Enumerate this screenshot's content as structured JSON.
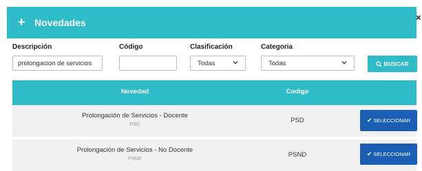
{
  "header": {
    "plus_icon": "+",
    "title": "Novedades",
    "close_icon": "×"
  },
  "filters": {
    "descripcion_label": "Descripción",
    "descripcion_value": "prolongacion de servicios",
    "codigo_label": "Código",
    "codigo_value": "",
    "clasificacion_label": "Clasificación",
    "clasificacion_value": "Todas",
    "categoria_label": "Categoria",
    "categoria_value": "Todas",
    "buscar_label": "BUSCAR"
  },
  "table": {
    "headers": [
      "Novedad",
      "Codigo"
    ],
    "rows": [
      {
        "description": "Prolongación de Servicios - Docente",
        "sub": "PSD",
        "code": "PSD",
        "action": "SELECCIONAR"
      },
      {
        "description": "Prolongación de Servicios - No Docente",
        "sub": "PSND",
        "code": "PSND",
        "action": "SELECCIONAR"
      }
    ]
  },
  "colors": {
    "accent": "#2fbcc9",
    "primary_button": "#1a5fb4",
    "row_bg": "#f1f1f1"
  },
  "icons": {
    "search": "search-icon",
    "check": "check-icon",
    "chevron": "chevron-down-icon",
    "close": "close-icon"
  }
}
